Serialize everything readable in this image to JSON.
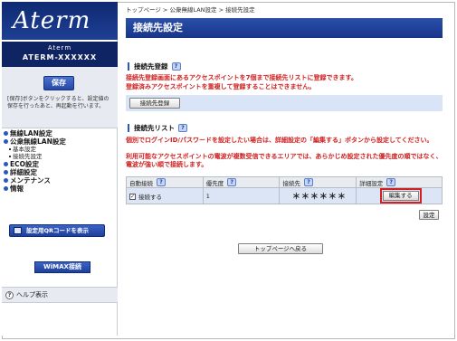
{
  "sidebar": {
    "logo": "Aterm",
    "model_line1": "Aterm",
    "model_line2": "ATERM-XXXXXX",
    "save_label": "保存",
    "save_desc": "[保存]ボタンをクリックすると、設定値の保存を行ったあと、再起動を行います。",
    "menu": [
      {
        "label": "無線LAN設定"
      },
      {
        "label": "公衆無線LAN設定"
      },
      {
        "label": "基本設定",
        "sub": true
      },
      {
        "label": "接続先設定",
        "sub": true
      },
      {
        "label": "ECO設定"
      },
      {
        "label": "詳細設定"
      },
      {
        "label": "メンテナンス"
      },
      {
        "label": "情報"
      }
    ],
    "qr_label": "設定用QRコードを表示",
    "wimax_label": "WiMAX接続",
    "help_label": "ヘルプ表示"
  },
  "main": {
    "breadcrumb": "トップページ > 公衆無線LAN設定 > 接続先設定",
    "title": "接続先設定",
    "register": {
      "heading": "接続先登録",
      "note1": "接続先登録画面にあるアクセスポイントを7個まで接続先リストに登録できます。",
      "note2": "登録済みアクセスポイントを重複して登録することはできません。",
      "button": "接続先登録"
    },
    "list": {
      "heading": "接続先リスト",
      "note1": "個別でログインID/パスワードを設定したい場合は、詳細設定の「編集する」ボタンから設定してください。",
      "note2": "利用可能なアクセスポイントの電波が複数受信できるエリアでは、あらかじめ設定された優先度の順ではなく、電波が強い順で接続します。",
      "headers": [
        "自動接続",
        "優先度",
        "接続先",
        "詳細設定"
      ],
      "rows": [
        {
          "auto": "接続する",
          "priority": "1",
          "dest": "＊＊＊＊＊＊",
          "edit": "編集する"
        }
      ],
      "set_button": "設定"
    },
    "back_button": "トップページへ戻る"
  },
  "colors": {
    "accent": "#17358a",
    "warning": "#d01f1f",
    "band": "#d9e4f6"
  }
}
